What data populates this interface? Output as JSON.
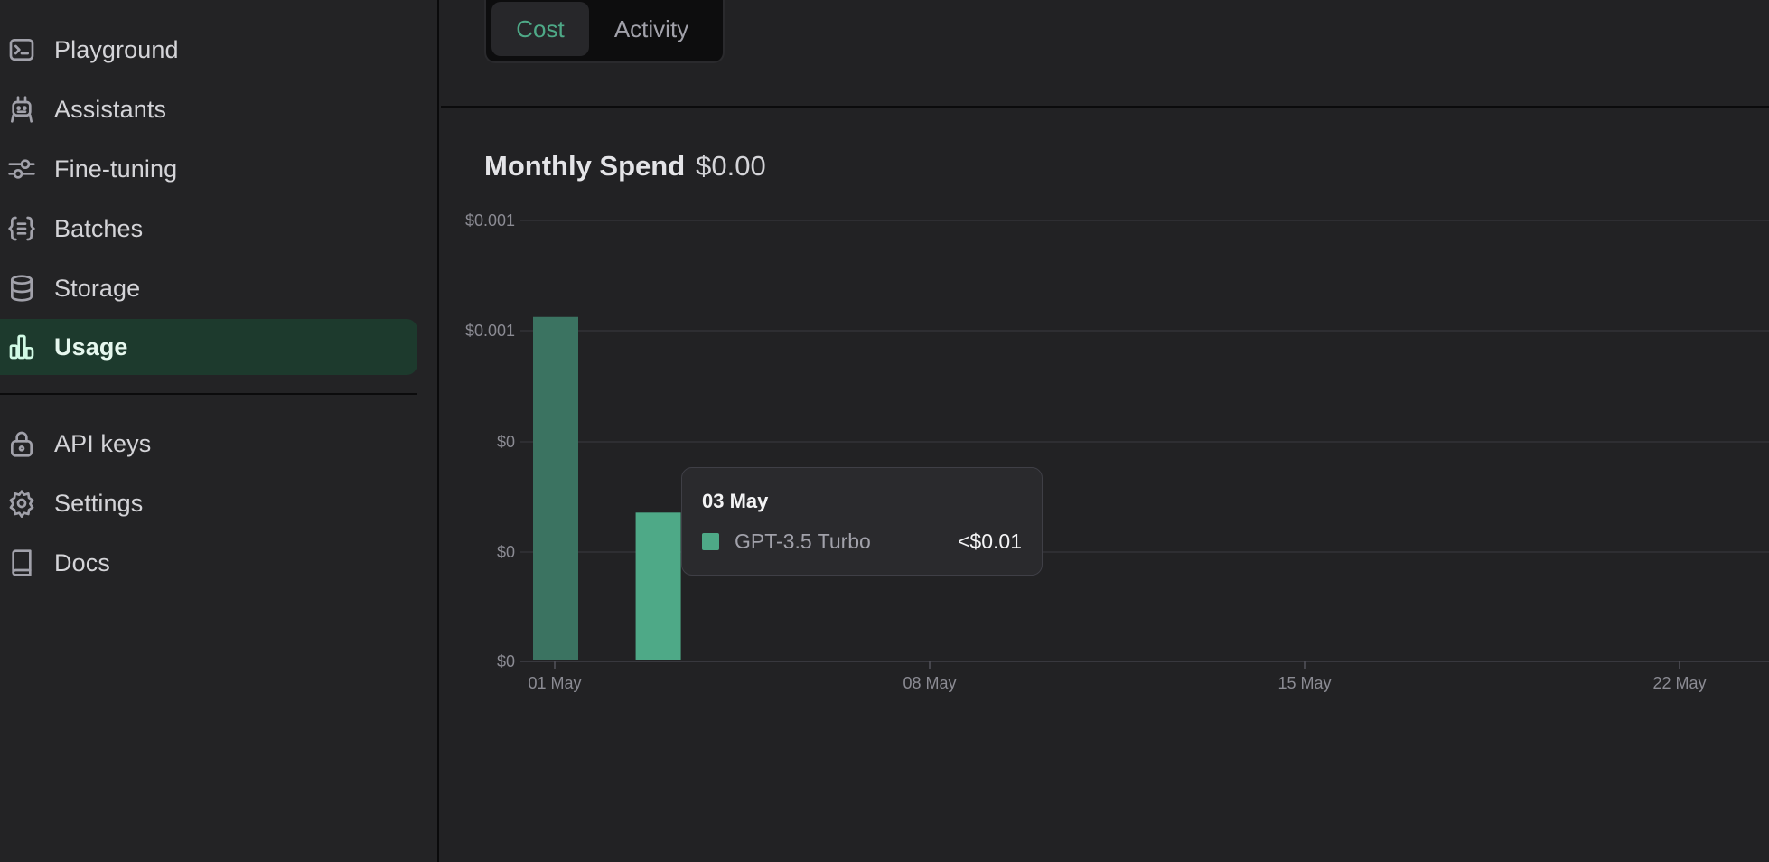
{
  "sidebar": {
    "items": [
      {
        "label": "Playground",
        "icon": "terminal-icon",
        "active": false
      },
      {
        "label": "Assistants",
        "icon": "robot-icon",
        "active": false
      },
      {
        "label": "Fine-tuning",
        "icon": "sliders-icon",
        "active": false
      },
      {
        "label": "Batches",
        "icon": "braces-list-icon",
        "active": false
      },
      {
        "label": "Storage",
        "icon": "database-icon",
        "active": false
      },
      {
        "label": "Usage",
        "icon": "bar-chart-icon",
        "active": true
      },
      {
        "label": "API keys",
        "icon": "lock-icon",
        "active": false
      },
      {
        "label": "Settings",
        "icon": "gear-icon",
        "active": false
      },
      {
        "label": "Docs",
        "icon": "book-icon",
        "active": false
      }
    ]
  },
  "tabs": {
    "cost": "Cost",
    "activity": "Activity",
    "selected": "Cost"
  },
  "spend": {
    "label": "Monthly Spend",
    "value": "$0.00"
  },
  "tooltip": {
    "date": "03 May",
    "series": "GPT-3.5 Turbo",
    "amount": "<$0.01"
  },
  "colors": {
    "accent": "#4ea987",
    "active_nav_bg": "#1d3a2d",
    "bar_dim": "#3b7361"
  },
  "chart_data": {
    "type": "bar",
    "ytick_labels": [
      "$0.001",
      "$0.001",
      "$0",
      "$0",
      "$0"
    ],
    "xtick_labels": [
      "01 May",
      "08 May",
      "15 May",
      "22 May"
    ],
    "series": [
      {
        "name": "GPT-3.5 Turbo",
        "points": [
          {
            "x": "01 May",
            "value": 0.00125
          },
          {
            "x": "03 May",
            "value": 0.00054
          }
        ]
      }
    ],
    "ylim": [
      0,
      0.0016
    ],
    "grid": true,
    "highlighted": "03 May"
  }
}
